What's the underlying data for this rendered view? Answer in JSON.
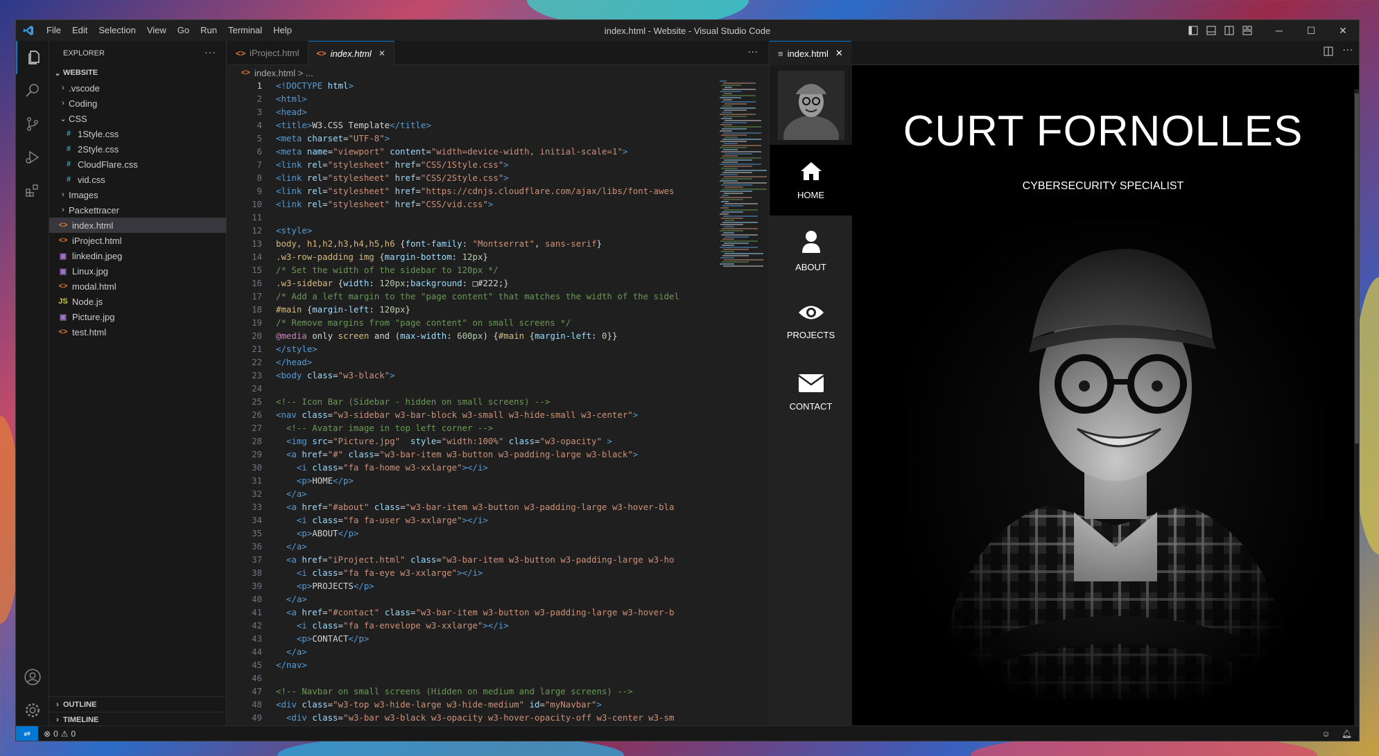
{
  "window": {
    "title": "index.html - Website - Visual Studio Code",
    "menu": [
      "File",
      "Edit",
      "Selection",
      "View",
      "Go",
      "Run",
      "Terminal",
      "Help"
    ]
  },
  "explorer": {
    "header": "EXPLORER",
    "more": "···",
    "root": "WEBSITE",
    "items": [
      {
        "label": ".vscode",
        "type": "folder",
        "open": false,
        "depth": 1
      },
      {
        "label": "Coding",
        "type": "folder",
        "open": false,
        "depth": 1
      },
      {
        "label": "CSS",
        "type": "folder",
        "open": true,
        "depth": 1
      },
      {
        "label": "1Style.css",
        "type": "css",
        "depth": 2
      },
      {
        "label": "2Style.css",
        "type": "css",
        "depth": 2
      },
      {
        "label": "CloudFlare.css",
        "type": "css",
        "depth": 2
      },
      {
        "label": "vid.css",
        "type": "css",
        "depth": 2
      },
      {
        "label": "Images",
        "type": "folder",
        "open": false,
        "depth": 1
      },
      {
        "label": "Packettracer",
        "type": "folder",
        "open": false,
        "depth": 1
      },
      {
        "label": "index.html",
        "type": "html",
        "depth": 1,
        "active": true
      },
      {
        "label": "iProject.html",
        "type": "html",
        "depth": 1
      },
      {
        "label": "linkedin.jpeg",
        "type": "img",
        "depth": 1
      },
      {
        "label": "Linux.jpg",
        "type": "img",
        "depth": 1
      },
      {
        "label": "modal.html",
        "type": "html",
        "depth": 1
      },
      {
        "label": "Node.js",
        "type": "js",
        "depth": 1
      },
      {
        "label": "Picture.jpg",
        "type": "img",
        "depth": 1
      },
      {
        "label": "test.html",
        "type": "html",
        "depth": 1
      }
    ],
    "outline": "OUTLINE",
    "timeline": "TIMELINE"
  },
  "editor": {
    "tabs": [
      {
        "label": "iProject.html",
        "active": false
      },
      {
        "label": "index.html",
        "active": true,
        "close": "✕"
      }
    ],
    "more": "···",
    "breadcrumb": "index.html > ...",
    "lines": [
      [
        [
          "t-tag",
          "<!DOCTYPE "
        ],
        [
          "t-attr",
          "html"
        ],
        [
          "t-tag",
          ">"
        ]
      ],
      [
        [
          "t-tag",
          "<html>"
        ]
      ],
      [
        [
          "t-tag",
          "<head>"
        ]
      ],
      [
        [
          "t-tag",
          "<title>"
        ],
        [
          "t-txt",
          "W3.CSS Template"
        ],
        [
          "t-tag",
          "</title>"
        ]
      ],
      [
        [
          "t-tag",
          "<meta "
        ],
        [
          "t-attr",
          "charset"
        ],
        [
          "t-txt",
          "="
        ],
        [
          "t-str",
          "\"UTF-8\""
        ],
        [
          "t-tag",
          ">"
        ]
      ],
      [
        [
          "t-tag",
          "<meta "
        ],
        [
          "t-attr",
          "name"
        ],
        [
          "t-txt",
          "="
        ],
        [
          "t-str",
          "\"viewport\" "
        ],
        [
          "t-attr",
          "content"
        ],
        [
          "t-txt",
          "="
        ],
        [
          "t-str",
          "\"width=device-width, initial-scale=1\""
        ],
        [
          "t-tag",
          ">"
        ]
      ],
      [
        [
          "t-tag",
          "<link "
        ],
        [
          "t-attr",
          "rel"
        ],
        [
          "t-txt",
          "="
        ],
        [
          "t-str",
          "\"stylesheet\" "
        ],
        [
          "t-attr",
          "href"
        ],
        [
          "t-txt",
          "="
        ],
        [
          "t-str",
          "\"CSS/1Style.css\""
        ],
        [
          "t-tag",
          ">"
        ]
      ],
      [
        [
          "t-tag",
          "<link "
        ],
        [
          "t-attr",
          "rel"
        ],
        [
          "t-txt",
          "="
        ],
        [
          "t-str",
          "\"stylesheet\" "
        ],
        [
          "t-attr",
          "href"
        ],
        [
          "t-txt",
          "="
        ],
        [
          "t-str",
          "\"CSS/2Style.css\""
        ],
        [
          "t-tag",
          ">"
        ]
      ],
      [
        [
          "t-tag",
          "<link "
        ],
        [
          "t-attr",
          "rel"
        ],
        [
          "t-txt",
          "="
        ],
        [
          "t-str",
          "\"stylesheet\" "
        ],
        [
          "t-attr",
          "href"
        ],
        [
          "t-txt",
          "="
        ],
        [
          "t-str",
          "\"https://cdnjs.cloudflare.com/ajax/libs/font-awes"
        ]
      ],
      [
        [
          "t-tag",
          "<link "
        ],
        [
          "t-attr",
          "rel"
        ],
        [
          "t-txt",
          "="
        ],
        [
          "t-str",
          "\"stylesheet\" "
        ],
        [
          "t-attr",
          "href"
        ],
        [
          "t-txt",
          "="
        ],
        [
          "t-str",
          "\"CSS/vid.css\""
        ],
        [
          "t-tag",
          ">"
        ]
      ],
      [],
      [
        [
          "t-tag",
          "<style>"
        ]
      ],
      [
        [
          "t-sel",
          "body, h1,h2,h3,h4,h5,h6 "
        ],
        [
          "t-txt",
          "{"
        ],
        [
          "t-prop",
          "font-family"
        ],
        [
          "t-txt",
          ": "
        ],
        [
          "t-val",
          "\"Montserrat\""
        ],
        [
          "t-txt",
          ", "
        ],
        [
          "t-val",
          "sans-serif"
        ],
        [
          "t-txt",
          "}"
        ]
      ],
      [
        [
          "t-sel",
          ".w3-row-padding img "
        ],
        [
          "t-txt",
          "{"
        ],
        [
          "t-prop",
          "margin-bottom"
        ],
        [
          "t-txt",
          ": "
        ],
        [
          "t-num",
          "12px"
        ],
        [
          "t-txt",
          "}"
        ]
      ],
      [
        [
          "t-cmt",
          "/* Set the width of the sidebar to 120px */"
        ]
      ],
      [
        [
          "t-sel",
          ".w3-sidebar "
        ],
        [
          "t-txt",
          "{"
        ],
        [
          "t-prop",
          "width"
        ],
        [
          "t-txt",
          ": "
        ],
        [
          "t-num",
          "120px"
        ],
        [
          "t-txt",
          ";"
        ],
        [
          "t-prop",
          "background"
        ],
        [
          "t-txt",
          ": "
        ],
        [
          "t-txt",
          "□#222;}"
        ]
      ],
      [
        [
          "t-cmt",
          "/* Add a left margin to the \"page content\" that matches the width of the sidel"
        ]
      ],
      [
        [
          "t-sel",
          "#main "
        ],
        [
          "t-txt",
          "{"
        ],
        [
          "t-prop",
          "margin-left"
        ],
        [
          "t-txt",
          ": "
        ],
        [
          "t-num",
          "120px"
        ],
        [
          "t-txt",
          "}"
        ]
      ],
      [
        [
          "t-cmt",
          "/* Remove margins from \"page content\" on small screens */"
        ]
      ],
      [
        [
          "t-kw",
          "@media "
        ],
        [
          "t-txt",
          "only "
        ],
        [
          "t-sel",
          "screen "
        ],
        [
          "t-txt",
          "and ("
        ],
        [
          "t-prop",
          "max-width"
        ],
        [
          "t-txt",
          ": "
        ],
        [
          "t-num",
          "600px"
        ],
        [
          "t-txt",
          ") {"
        ],
        [
          "t-sel",
          "#main "
        ],
        [
          "t-txt",
          "{"
        ],
        [
          "t-prop",
          "margin-left"
        ],
        [
          "t-txt",
          ": "
        ],
        [
          "t-num",
          "0"
        ],
        [
          "t-txt",
          "}}"
        ]
      ],
      [
        [
          "t-tag",
          "</style>"
        ]
      ],
      [
        [
          "t-tag",
          "</head>"
        ]
      ],
      [
        [
          "t-tag",
          "<body "
        ],
        [
          "t-attr",
          "class"
        ],
        [
          "t-txt",
          "="
        ],
        [
          "t-str",
          "\"w3-black\""
        ],
        [
          "t-tag",
          ">"
        ]
      ],
      [],
      [
        [
          "t-cmt",
          "<!-- Icon Bar (Sidebar - hidden on small screens) -->"
        ]
      ],
      [
        [
          "t-tag",
          "<nav "
        ],
        [
          "t-attr",
          "class"
        ],
        [
          "t-txt",
          "="
        ],
        [
          "t-str",
          "\"w3-sidebar w3-bar-block w3-small w3-hide-small w3-center\""
        ],
        [
          "t-tag",
          ">"
        ]
      ],
      [
        [
          "t-cmt",
          "  <!-- Avatar image in top left corner -->"
        ]
      ],
      [
        [
          "t-tag",
          "  <img "
        ],
        [
          "t-attr",
          "src"
        ],
        [
          "t-txt",
          "="
        ],
        [
          "t-str",
          "\"Picture.jpg\"  "
        ],
        [
          "t-attr",
          "style"
        ],
        [
          "t-txt",
          "="
        ],
        [
          "t-str",
          "\"width:100%\" "
        ],
        [
          "t-attr",
          "class"
        ],
        [
          "t-txt",
          "="
        ],
        [
          "t-str",
          "\"w3-opacity\" "
        ],
        [
          "t-tag",
          ">"
        ]
      ],
      [
        [
          "t-tag",
          "  <a "
        ],
        [
          "t-attr",
          "href"
        ],
        [
          "t-txt",
          "="
        ],
        [
          "t-str",
          "\"#\" "
        ],
        [
          "t-attr",
          "class"
        ],
        [
          "t-txt",
          "="
        ],
        [
          "t-str",
          "\"w3-bar-item w3-button w3-padding-large w3-black\""
        ],
        [
          "t-tag",
          ">"
        ]
      ],
      [
        [
          "t-tag",
          "    <i "
        ],
        [
          "t-attr",
          "class"
        ],
        [
          "t-txt",
          "="
        ],
        [
          "t-str",
          "\"fa fa-home w3-xxlarge\""
        ],
        [
          "t-tag",
          "></i>"
        ]
      ],
      [
        [
          "t-tag",
          "    <p>"
        ],
        [
          "t-txt",
          "HOME"
        ],
        [
          "t-tag",
          "</p>"
        ]
      ],
      [
        [
          "t-tag",
          "  </a>"
        ]
      ],
      [
        [
          "t-tag",
          "  <a "
        ],
        [
          "t-attr",
          "href"
        ],
        [
          "t-txt",
          "="
        ],
        [
          "t-str",
          "\"#about\" "
        ],
        [
          "t-attr",
          "class"
        ],
        [
          "t-txt",
          "="
        ],
        [
          "t-str",
          "\"w3-bar-item w3-button w3-padding-large w3-hover-bla"
        ]
      ],
      [
        [
          "t-tag",
          "    <i "
        ],
        [
          "t-attr",
          "class"
        ],
        [
          "t-txt",
          "="
        ],
        [
          "t-str",
          "\"fa fa-user w3-xxlarge\""
        ],
        [
          "t-tag",
          "></i>"
        ]
      ],
      [
        [
          "t-tag",
          "    <p>"
        ],
        [
          "t-txt",
          "ABOUT"
        ],
        [
          "t-tag",
          "</p>"
        ]
      ],
      [
        [
          "t-tag",
          "  </a>"
        ]
      ],
      [
        [
          "t-tag",
          "  <a "
        ],
        [
          "t-attr",
          "href"
        ],
        [
          "t-txt",
          "="
        ],
        [
          "t-str",
          "\"iProject.html\" "
        ],
        [
          "t-attr",
          "class"
        ],
        [
          "t-txt",
          "="
        ],
        [
          "t-str",
          "\"w3-bar-item w3-button w3-padding-large w3-ho"
        ]
      ],
      [
        [
          "t-tag",
          "    <i "
        ],
        [
          "t-attr",
          "class"
        ],
        [
          "t-txt",
          "="
        ],
        [
          "t-str",
          "\"fa fa-eye w3-xxlarge\""
        ],
        [
          "t-tag",
          "></i>"
        ]
      ],
      [
        [
          "t-tag",
          "    <p>"
        ],
        [
          "t-txt",
          "PROJECTS"
        ],
        [
          "t-tag",
          "</p>"
        ]
      ],
      [
        [
          "t-tag",
          "  </a>"
        ]
      ],
      [
        [
          "t-tag",
          "  <a "
        ],
        [
          "t-attr",
          "href"
        ],
        [
          "t-txt",
          "="
        ],
        [
          "t-str",
          "\"#contact\" "
        ],
        [
          "t-attr",
          "class"
        ],
        [
          "t-txt",
          "="
        ],
        [
          "t-str",
          "\"w3-bar-item w3-button w3-padding-large w3-hover-b"
        ]
      ],
      [
        [
          "t-tag",
          "    <i "
        ],
        [
          "t-attr",
          "class"
        ],
        [
          "t-txt",
          "="
        ],
        [
          "t-str",
          "\"fa fa-envelope w3-xxlarge\""
        ],
        [
          "t-tag",
          "></i>"
        ]
      ],
      [
        [
          "t-tag",
          "    <p>"
        ],
        [
          "t-txt",
          "CONTACT"
        ],
        [
          "t-tag",
          "</p>"
        ]
      ],
      [
        [
          "t-tag",
          "  </a>"
        ]
      ],
      [
        [
          "t-tag",
          "</nav>"
        ]
      ],
      [],
      [
        [
          "t-cmt",
          "<!-- Navbar on small screens (Hidden on medium and large screens) -->"
        ]
      ],
      [
        [
          "t-tag",
          "<div "
        ],
        [
          "t-attr",
          "class"
        ],
        [
          "t-txt",
          "="
        ],
        [
          "t-str",
          "\"w3-top w3-hide-large w3-hide-medium\" "
        ],
        [
          "t-attr",
          "id"
        ],
        [
          "t-txt",
          "="
        ],
        [
          "t-str",
          "\"myNavbar\""
        ],
        [
          "t-tag",
          ">"
        ]
      ],
      [
        [
          "t-tag",
          "  <div "
        ],
        [
          "t-attr",
          "class"
        ],
        [
          "t-txt",
          "="
        ],
        [
          "t-str",
          "\"w3-bar w3-black w3-opacity w3-hover-opacity-off w3-center w3-sm"
        ]
      ]
    ]
  },
  "preview": {
    "tab": "index.html",
    "close": "✕",
    "site": {
      "title": "CURT FORNOLLES",
      "subtitle": "CYBERSECURITY SPECIALIST",
      "nav": [
        {
          "label": "HOME",
          "icon": "home-icon"
        },
        {
          "label": "ABOUT",
          "icon": "user-icon"
        },
        {
          "label": "PROJECTS",
          "icon": "eye-icon"
        },
        {
          "label": "CONTACT",
          "icon": "envelope-icon"
        }
      ]
    }
  },
  "statusbar": {
    "errors": "0",
    "warnings": "0"
  },
  "colors": {
    "accent": "#0078d4",
    "html_icon": "#e37933",
    "css_icon": "#519aba",
    "js_icon": "#cbcb41",
    "img_icon": "#a074c4"
  }
}
